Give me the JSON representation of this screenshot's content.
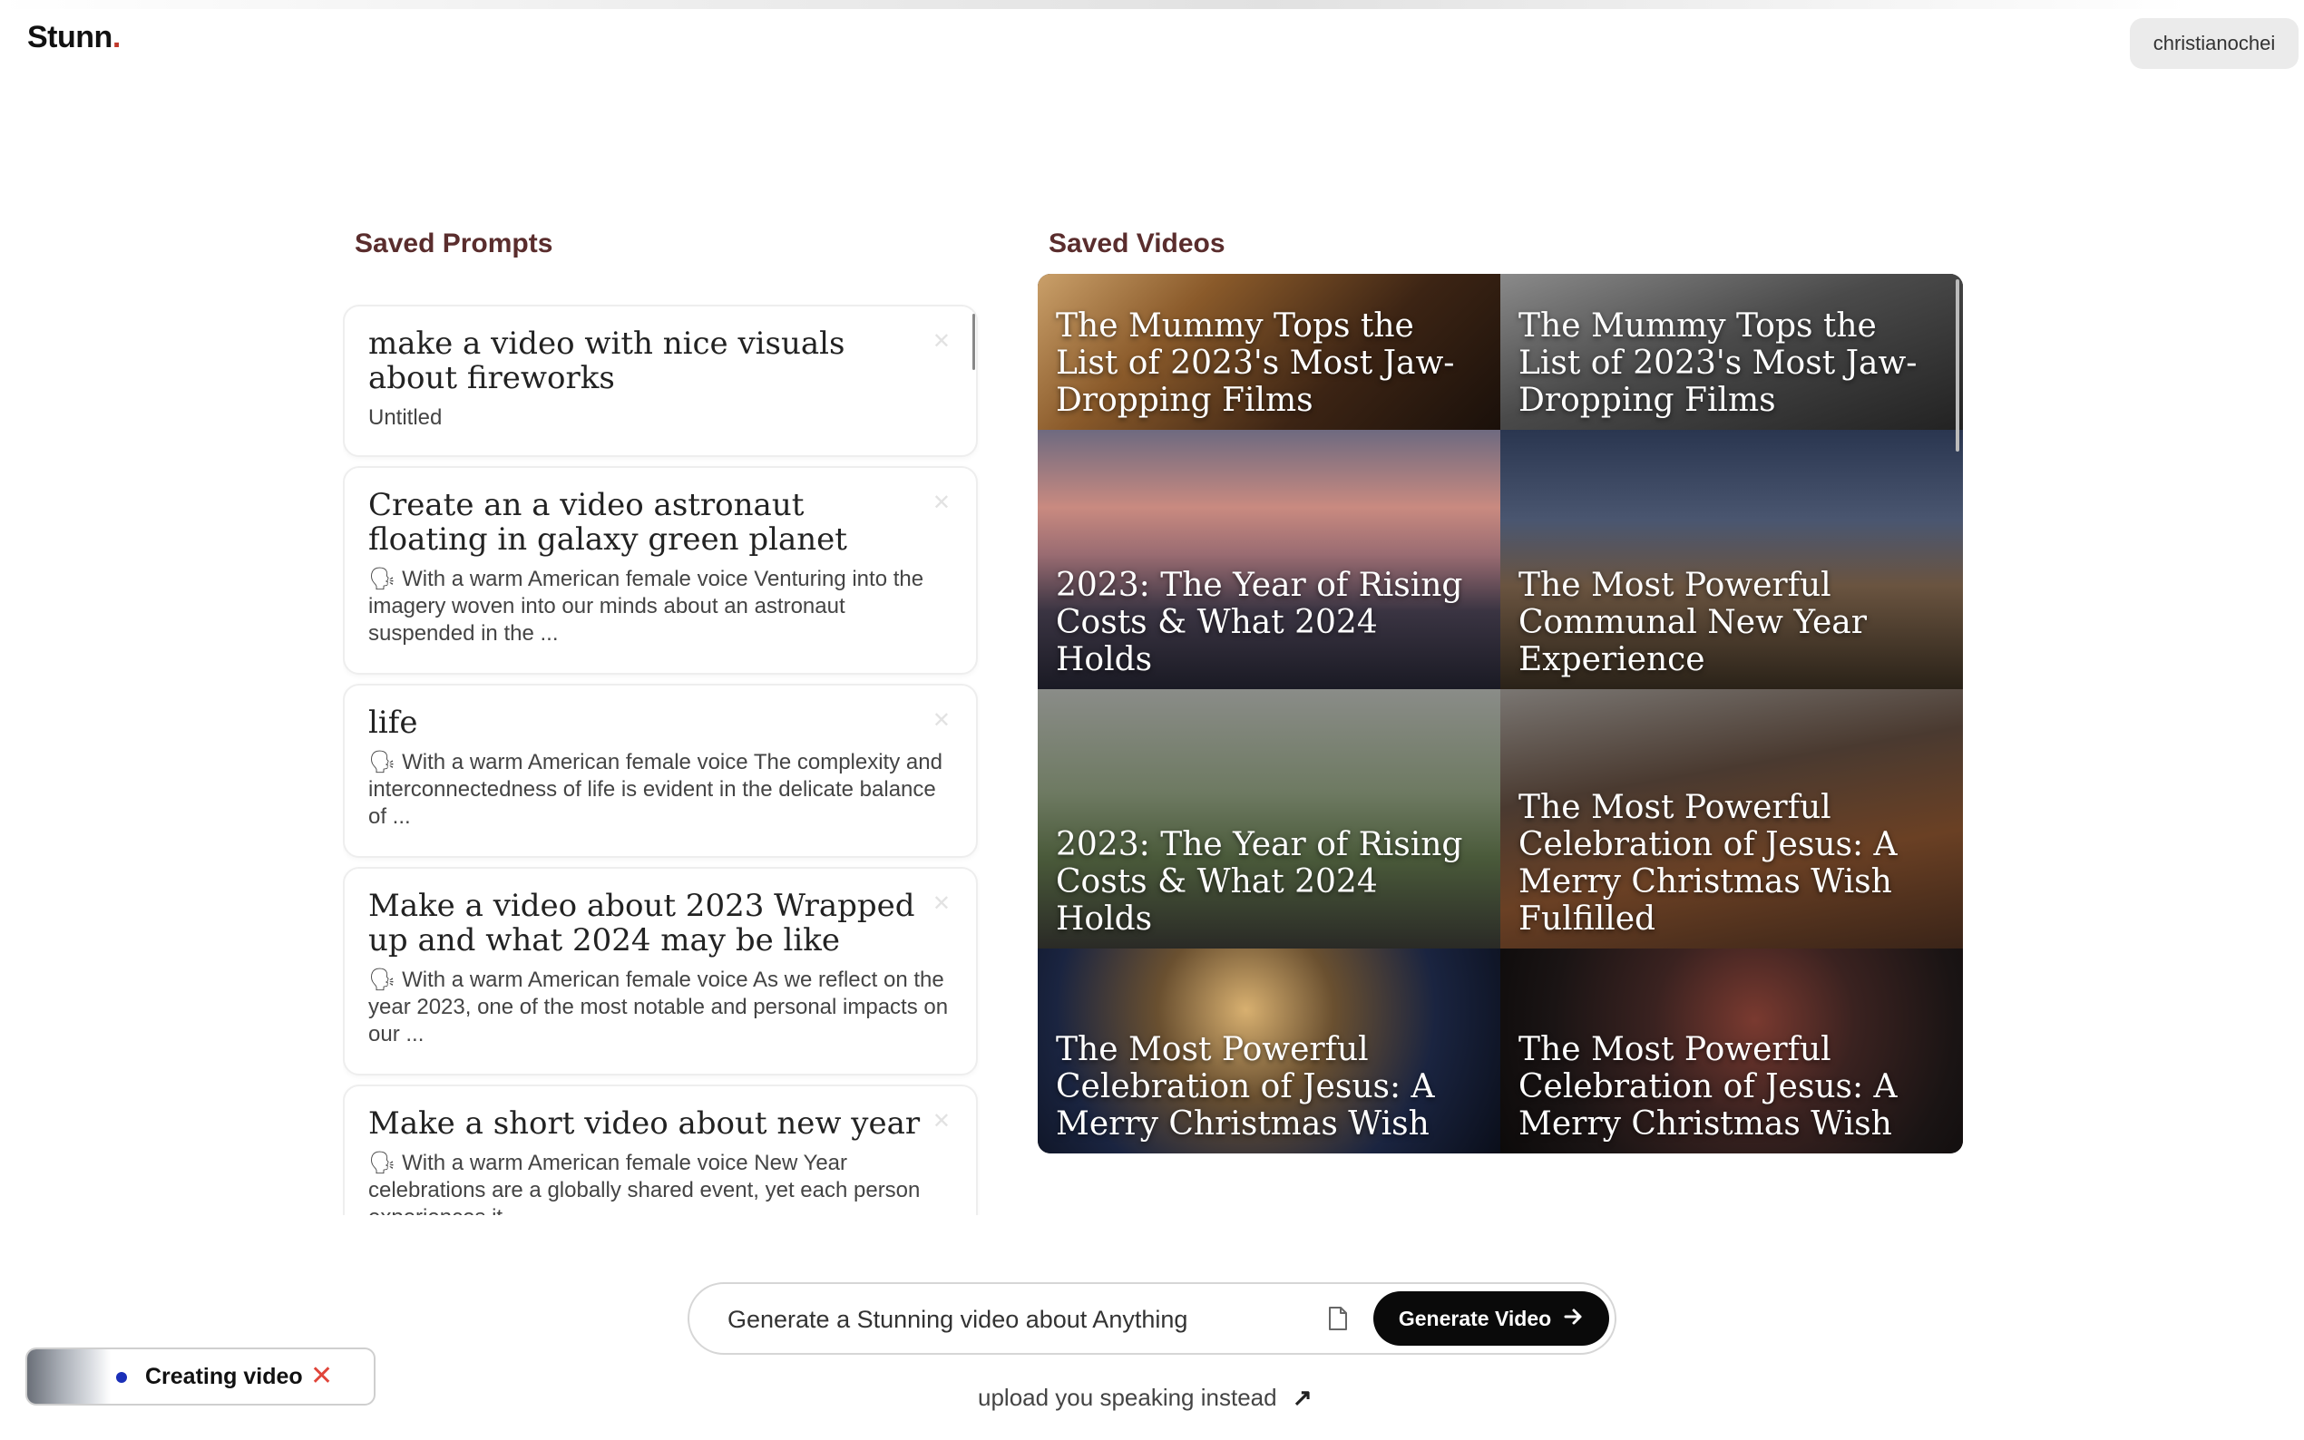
{
  "header": {
    "logo": "Stunn",
    "logo_dot": ".",
    "username": "christianochei"
  },
  "saved_prompts": {
    "title": "Saved Prompts",
    "items": [
      {
        "title": "make a video with nice visuals about fireworks",
        "subtitle": "Untitled"
      },
      {
        "title": "Create an a video astronaut floating in galaxy green planet",
        "subtitle": "🗣 With a warm American female voice Venturing into the imagery woven into our minds about an astronaut suspended in the ..."
      },
      {
        "title": "life",
        "subtitle": "🗣 With a warm American female voice The complexity and interconnectedness of life is evident in the delicate balance of ..."
      },
      {
        "title": "Make a video about 2023 Wrapped up and what 2024 may be like",
        "subtitle": "🗣 With a warm American female voice As we reflect on the year 2023, one of the most notable and personal impacts on our ..."
      },
      {
        "title": "Make a short video about new year",
        "subtitle": "🗣 With a warm American female voice New Year celebrations are a globally shared event, yet each person experiences it ..."
      }
    ],
    "close_icon": "close-icon"
  },
  "saved_videos": {
    "title": "Saved Videos",
    "items": [
      {
        "caption": "The Mummy Tops the List of 2023's Most Jaw-Dropping Films"
      },
      {
        "caption": "The Mummy Tops the List of 2023's Most Jaw-Dropping Films"
      },
      {
        "caption": "2023: The Year of Rising Costs & What 2024 Holds"
      },
      {
        "caption": "The Most Powerful Communal New Year Experience"
      },
      {
        "caption": "2023: The Year of Rising Costs & What 2024 Holds"
      },
      {
        "caption": "The Most Powerful Celebration of Jesus: A Merry Christmas Wish Fulfilled"
      },
      {
        "caption": "The Most Powerful Celebration of Jesus: A Merry Christmas Wish"
      },
      {
        "caption": "The Most Powerful Celebration of Jesus: A Merry Christmas Wish"
      }
    ]
  },
  "generator": {
    "placeholder": "Generate a Stunning video about Anything",
    "button_label": "Generate Video",
    "upload_link": "upload you speaking instead",
    "upload_icon": "arrow-up-right-icon"
  },
  "status": {
    "label": "Creating video",
    "dot_color": "#1a2fb8",
    "close_color": "#e0453a"
  }
}
